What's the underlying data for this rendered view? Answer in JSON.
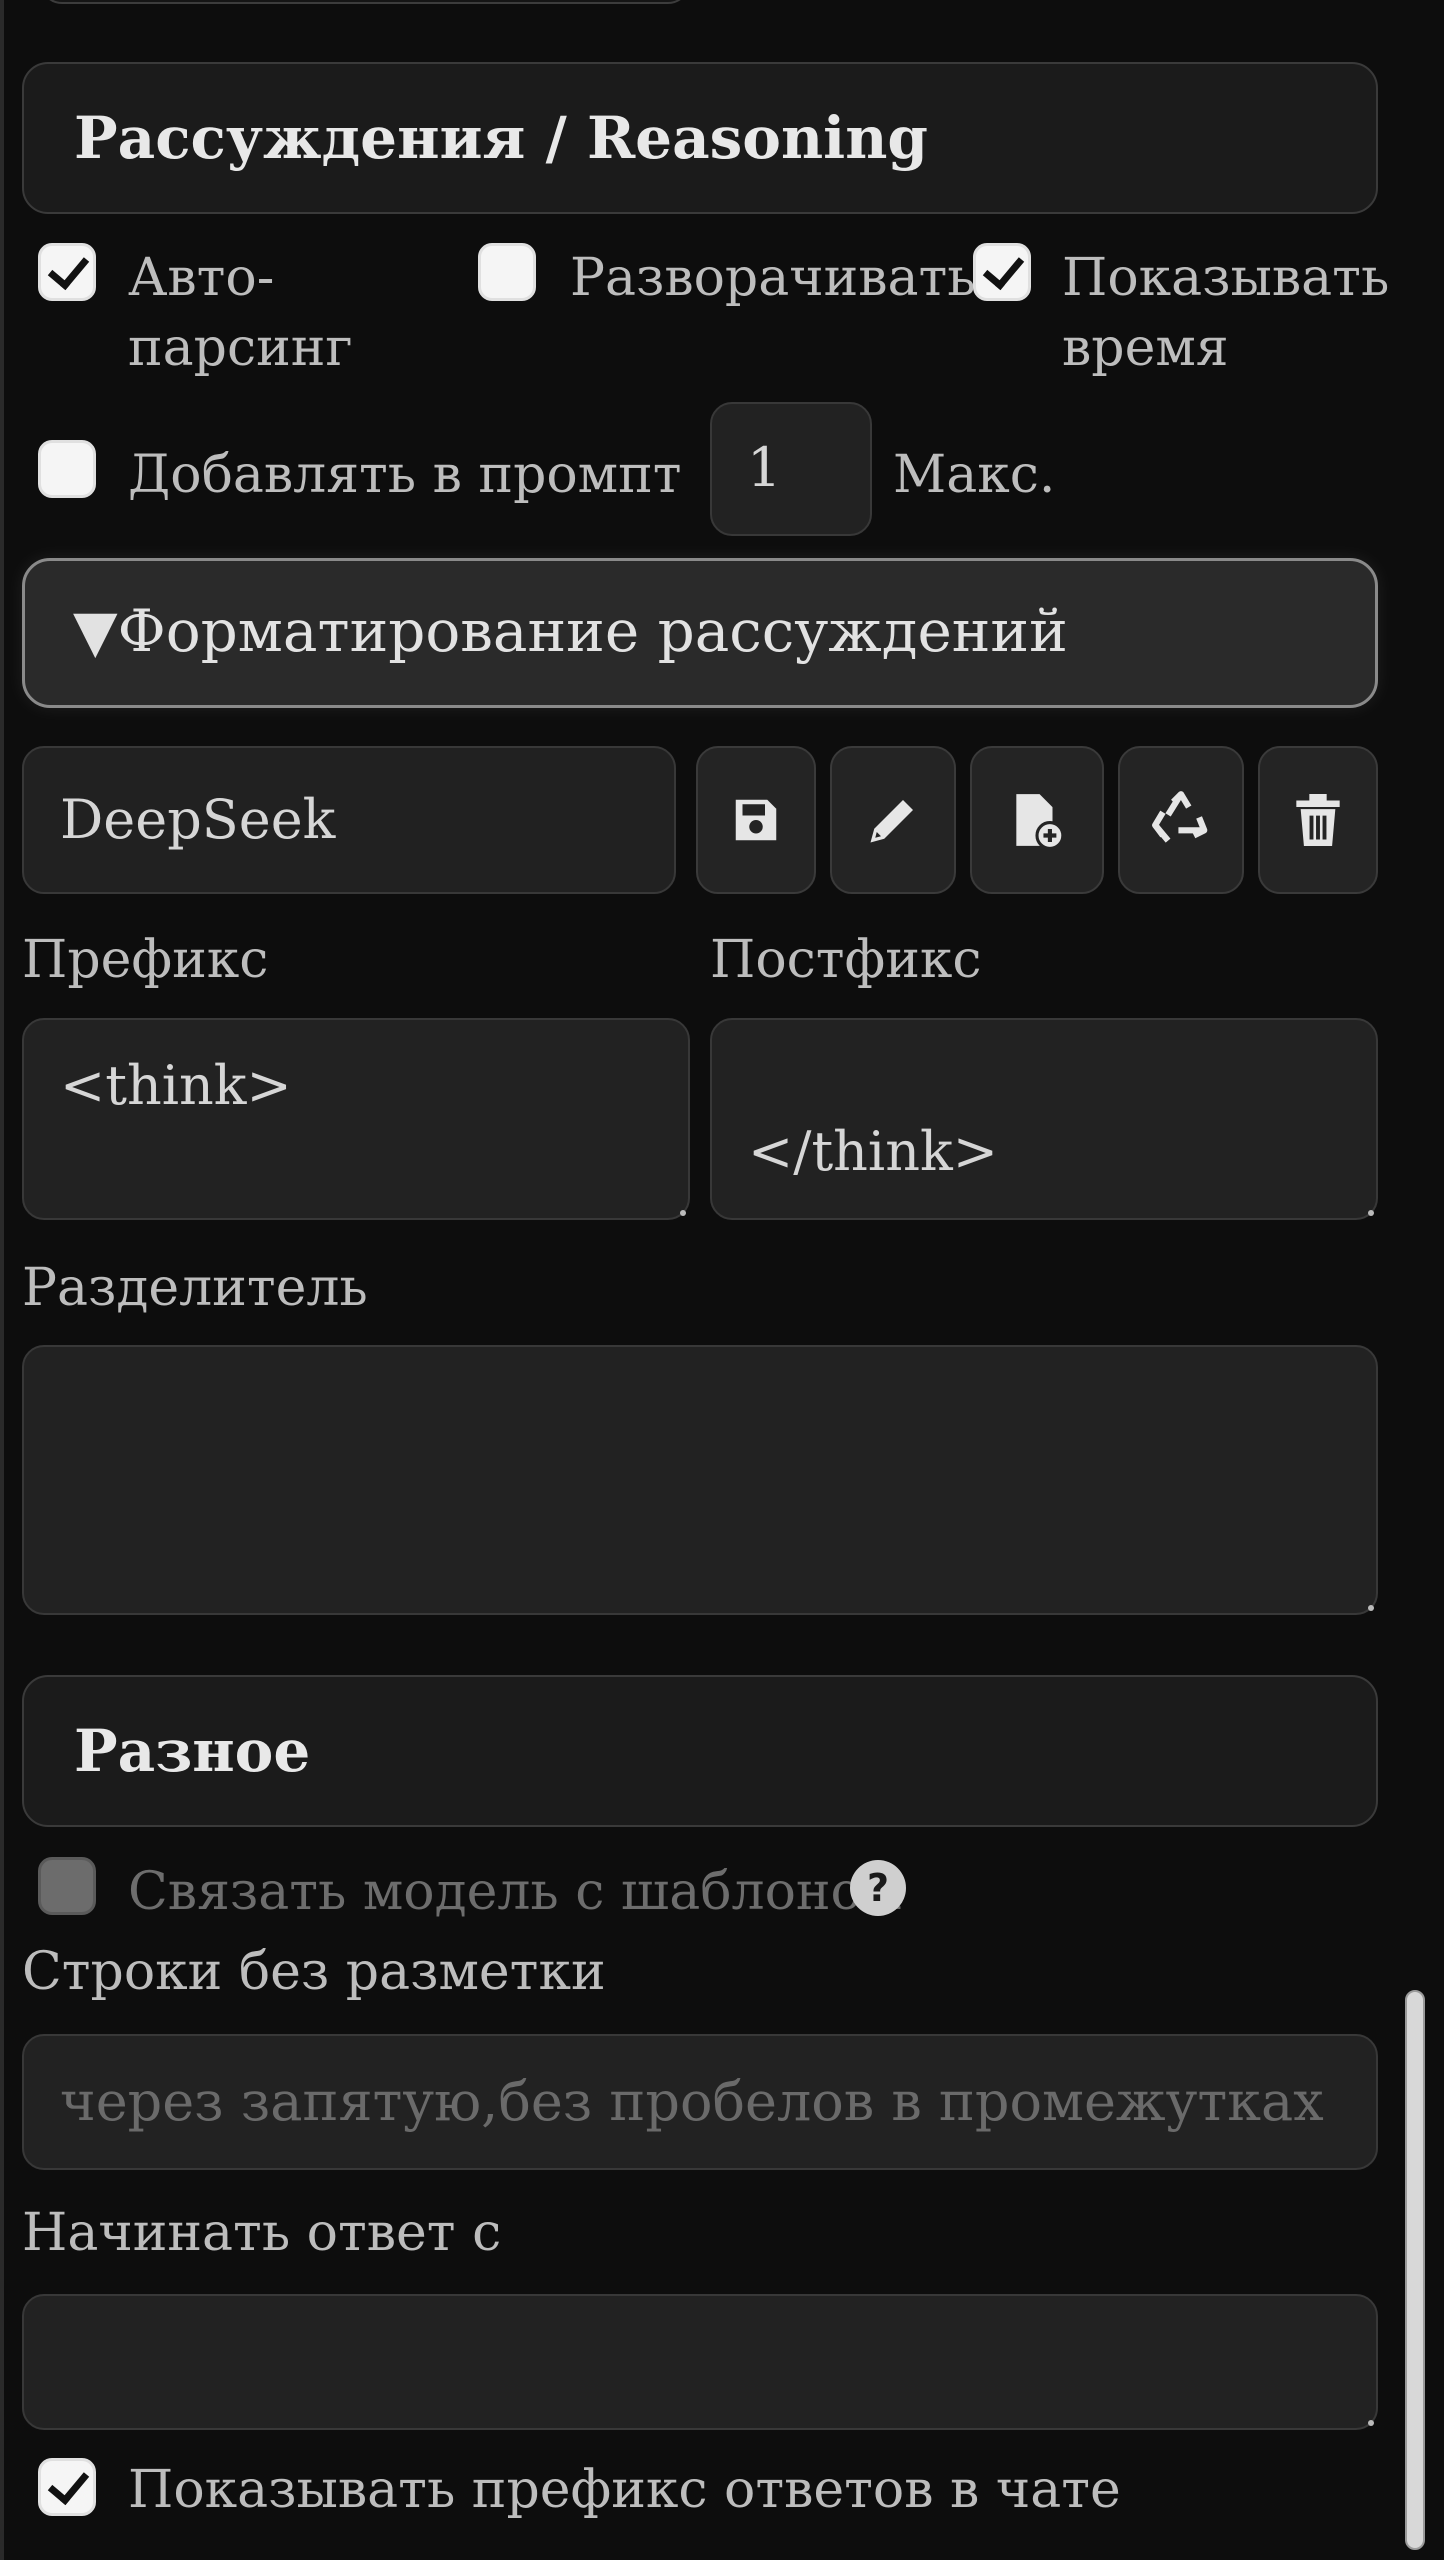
{
  "reasoning": {
    "title": "Рассуждения / Reasoning",
    "auto_parse_line1": "Авто-",
    "auto_parse_line2": "парсинг",
    "auto_expand": "Разворачивать",
    "show_time_line1": "Показывать",
    "show_time_line2": "время",
    "add_to_prompt": "Добавлять в промпт",
    "max_value": "1",
    "max_label": "Макс.",
    "checks": {
      "auto_parse": true,
      "auto_expand": false,
      "show_time": true,
      "add_to_prompt": false
    }
  },
  "formatting": {
    "summary": "▼Форматирование рассуждений",
    "preset_value": "DeepSeek",
    "icons": [
      "save-icon",
      "edit-icon",
      "file-add-icon",
      "recycle-icon",
      "trash-icon"
    ],
    "prefix_label": "Префикс",
    "prefix_value": "<think>",
    "suffix_label": "Постфикс",
    "suffix_value": "</think>",
    "separator_label": "Разделитель",
    "separator_value": ""
  },
  "misc": {
    "title": "Разное",
    "bind_model_label": "Связать модель с шаблоном",
    "help_glyph": "?",
    "nomarkdown_label": "Строки без разметки",
    "nomarkdown_placeholder": "через запятую,без пробелов в промежутках",
    "start_reply_label": "Начинать ответ с",
    "start_reply_value": "",
    "show_prefix_label": "Показывать префикс ответов в чате",
    "checks": {
      "bind_model": false,
      "show_prefix": true
    }
  }
}
